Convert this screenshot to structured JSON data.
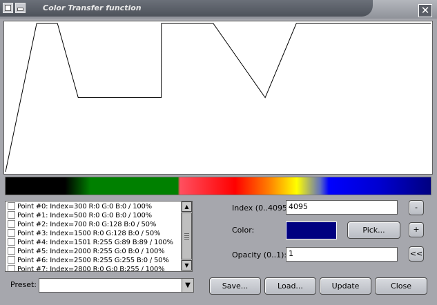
{
  "window": {
    "title": "Color Transfer function",
    "close_glyph": "✕",
    "buttons": [
      "window-menu-icon",
      "minimize-icon",
      "close-icon"
    ]
  },
  "chart_data": {
    "type": "line",
    "title": "",
    "xlabel": "",
    "ylabel": "",
    "xlim": [
      0,
      4095
    ],
    "ylim": [
      0,
      1
    ],
    "grid": false,
    "series": [
      {
        "x": [
          0,
          300,
          500,
          700,
          1500,
          1501,
          2000,
          2500,
          2800,
          4095
        ],
        "y": [
          0,
          1,
          1,
          0.5,
          0.5,
          1,
          1,
          0.5,
          1,
          1
        ]
      }
    ],
    "line_color": "#000000"
  },
  "colorbar": {
    "stops": [
      "#000000",
      "#008000",
      "#ff0000",
      "#ff8000",
      "#ffff00",
      "#0000ff",
      "#000080"
    ]
  },
  "points": {
    "items": [
      "Point #0: Index=300 R:0 G:0 B:0 / 100%",
      "Point #1: Index=500 R:0 G:0 B:0 / 100%",
      "Point #2: Index=700 R:0 G:128 B:0 / 50%",
      "Point #3: Index=1500 R:0 G:128 B:0 / 50%",
      "Point #4: Index=1501 R:255 G:89 B:89 / 100%",
      "Point #5: Index=2000 R:255 G:0 B:0 / 100%",
      "Point #6: Index=2500 R:255 G:255 B:0 / 50%",
      "Point #7: Index=2800 R:0 G:0 B:255 / 100%"
    ]
  },
  "preset": {
    "label": "Preset:",
    "value": ""
  },
  "form": {
    "index_label": "Index (0..4095):",
    "index_value": "4095",
    "color_label": "Color:",
    "color_value": "#000080",
    "pick_label": "Pick...",
    "opacity_label": "Opacity (0..1):",
    "opacity_value": "1",
    "minus_label": "-",
    "plus_label": "+",
    "back_label": "<<"
  },
  "footer": {
    "save_label": "Save...",
    "load_label": "Load...",
    "update_label": "Update",
    "close_label": "Close"
  }
}
